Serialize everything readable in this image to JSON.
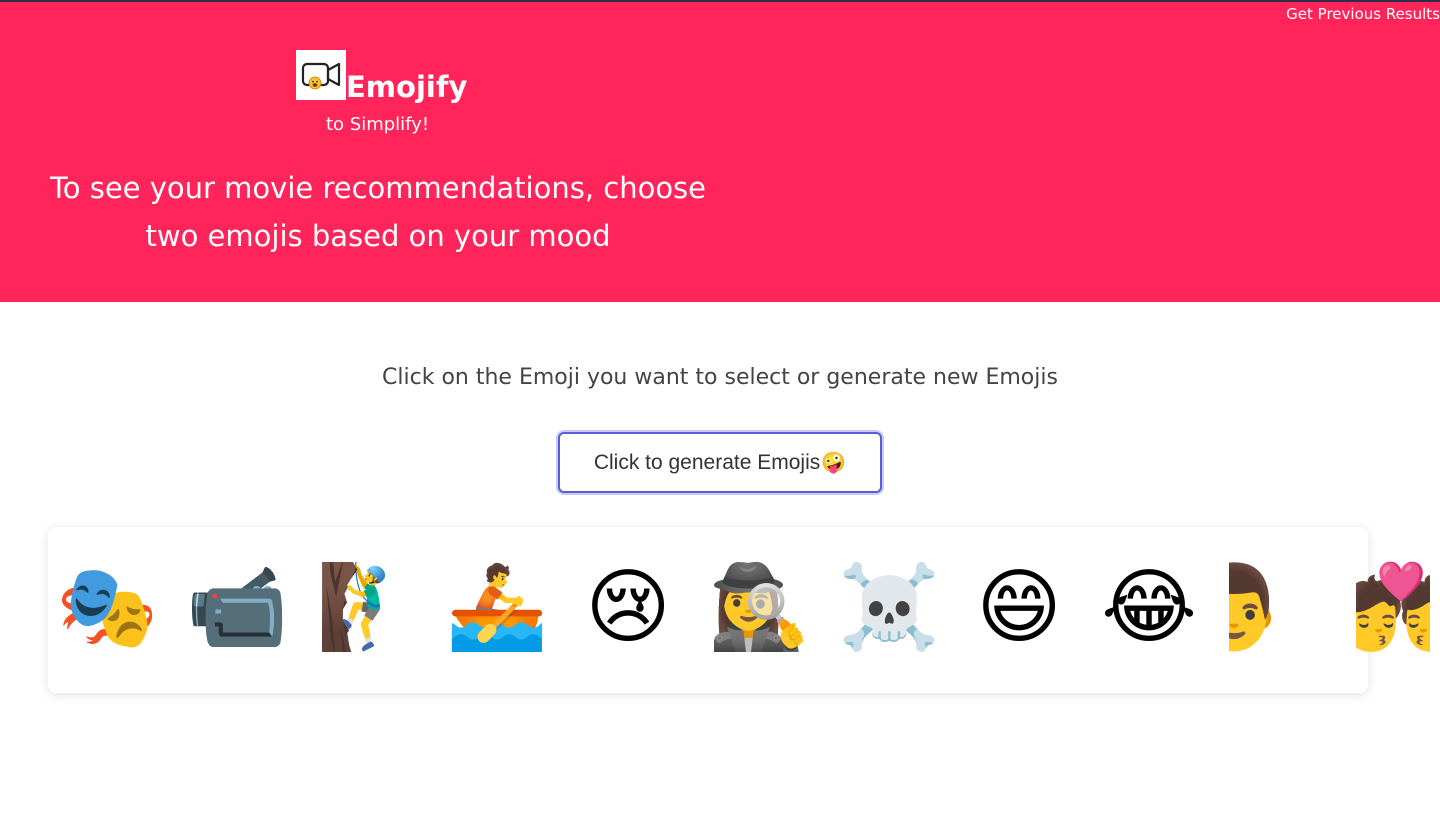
{
  "header": {
    "prev_results_link": "Get Previous Results",
    "logo_icon": "video-camera-face-icon",
    "brand_name": "Emojify",
    "tagline": "to Simplify!",
    "headline": "To see your movie recommendations, choose two emojis based on your mood",
    "background_color": "#ff2459"
  },
  "main": {
    "instruction": "Click on the Emoji you want to select or generate new Emojis",
    "generate_button": {
      "label": "Click to generate Emojis",
      "emoji": "🤪"
    }
  },
  "emoji_strip": {
    "items": [
      {
        "emoji": "🎭",
        "name": "performing-arts"
      },
      {
        "emoji": "📹",
        "name": "video-camera"
      },
      {
        "emoji": "🧗‍♂️",
        "name": "man-climbing"
      },
      {
        "emoji": "🚣",
        "name": "person-rowing-boat"
      },
      {
        "emoji": "😢",
        "name": "crying-face"
      },
      {
        "emoji": "🕵️‍♀️",
        "name": "woman-detective"
      },
      {
        "emoji": "☠️",
        "name": "skull-and-crossbones"
      },
      {
        "emoji": "😄",
        "name": "grinning-face-with-smiling-eyes"
      },
      {
        "emoji": "😂",
        "name": "face-with-tears-of-joy"
      },
      {
        "emoji": "👨",
        "name": "man-partial"
      },
      {
        "emoji": "💏",
        "name": "kiss-couple-partial"
      }
    ]
  }
}
